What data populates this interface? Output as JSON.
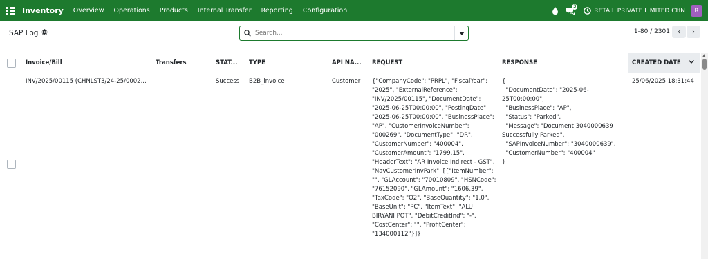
{
  "navbar": {
    "app_name": "Inventory",
    "menu": [
      "Overview",
      "Operations",
      "Products",
      "Internal Transfer",
      "Reporting",
      "Configuration"
    ],
    "chat_count": "3",
    "company": "RETAIL PRIVATE LIMITED CHN",
    "avatar_letter": "R",
    "brand_color": "#1d7a2e",
    "avatar_color": "#a05fbf"
  },
  "control": {
    "title": "SAP Log",
    "search_placeholder": "Search...",
    "pager_text": "1-80 / 2301"
  },
  "table": {
    "headers": {
      "invoice": "Invoice/Bill",
      "transfers": "Transfers",
      "status": "STAT...",
      "type": "TYPE",
      "api_name": "API NA...",
      "request": "REQUEST",
      "response": "RESPONSE",
      "created": "CREATED DATE"
    },
    "rows": [
      {
        "invoice": "INV/2025/00115 (CHNLST3/24-25/0002...",
        "transfers": "",
        "status": "Success",
        "type": "B2B_invoice",
        "api_name": "Customer",
        "request": "{\"CompanyCode\": \"PRPL\", \"FiscalYear\":\n\"2025\", \"ExternalReference\":\n\"INV/2025/00115\", \"DocumentDate\":\n\"2025-06-25T00:00:00\", \"PostingDate\":\n\"2025-06-25T00:00:00\", \"BusinessPlace\":\n\"AP\", \"CustomerInvoiceNumber\":\n\"000269\", \"DocumentType\": \"DR\",\n\"CustomerNumber\": \"400004\",\n\"CustomerAmount\": \"1799.15\",\n\"HeaderText\": \"AR Invoice Indirect - GST\",\n\"NavCustomerInvPark\": [{\"ItemNumber\":\n\"\", \"GLAccount\": \"70010809\", \"HSNCode\":\n\"76152090\", \"GLAmount\": \"1606.39\",\n\"TaxCode\": \"O2\", \"BaseQuantity\": \"1.0\",\n\"BaseUnit\": \"PC\", \"ItemText\": \"ALU\nBIRYANI POT\", \"DebitCreditInd\": \"-\",\n\"CostCenter\": \"\", \"ProfitCenter\":\n\"134000112\"}]}",
        "response": "{\n  \"DocumentDate\": \"2025-06-\n25T00:00:00\",\n  \"BusinessPlace\": \"AP\",\n  \"Status\": \"Parked\",\n  \"Message\": \"Document 3040000639\nSuccessfully Parked\",\n  \"SAPInvoiceNumber\": \"3040000639\",\n  \"CustomerNumber\": \"400004\"\n}",
        "created": "25/06/2025 18:31:44"
      }
    ]
  }
}
